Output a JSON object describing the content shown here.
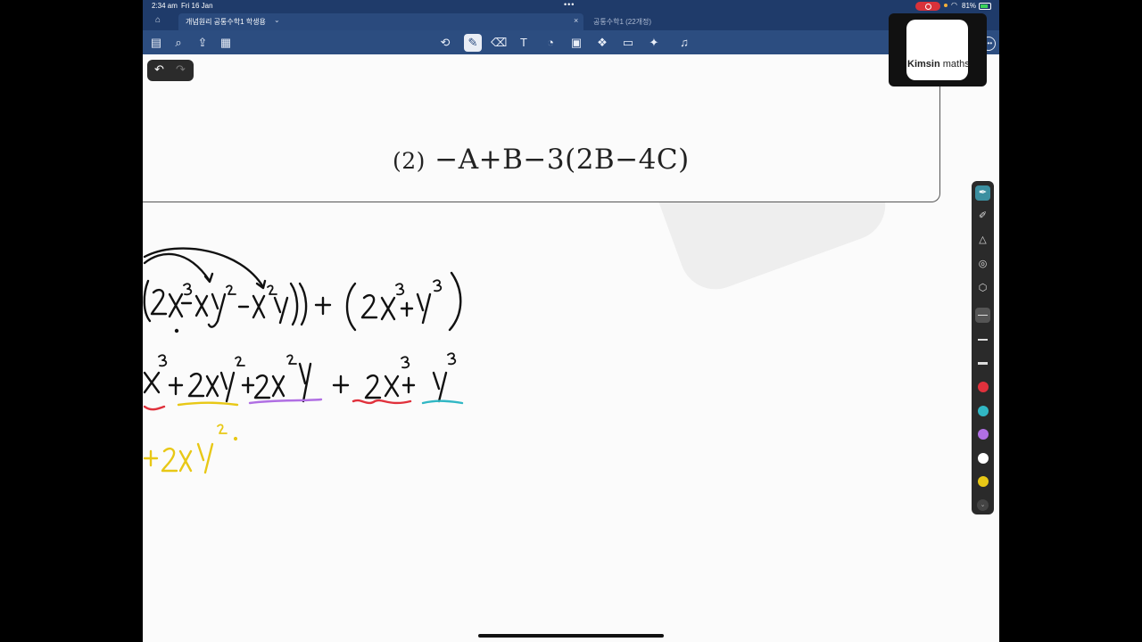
{
  "status": {
    "time": "2:34 am",
    "date": "Fri 16 Jan",
    "battery": "81%"
  },
  "tabs": [
    {
      "label": "개념원리 공통수학1 학생용"
    },
    {
      "label": "공통수학1 (22개정)"
    }
  ],
  "toolbar": {
    "icons": [
      "sidebar-icon",
      "search-icon",
      "share-icon",
      "bookmark-icon",
      "lasso-icon",
      "pen-icon",
      "eraser-icon",
      "text-box-icon",
      "shapes-icon",
      "image-icon",
      "elements-icon",
      "sticky-note-icon",
      "laser-pointer-icon",
      "microphone-icon",
      "more-icon"
    ],
    "selected": "pen-icon"
  },
  "document": {
    "problem_number": "(2)",
    "problem_expr": "−A+B−3(2B−4C)",
    "handwriting": {
      "line1": "(2x³ − xy² − x²y) + (2x³ + y³)",
      "line2": "x³ + 2xy² + 2x²y  +  2x³ + y³",
      "line3": "+ 2xy²"
    }
  },
  "pen_toolbar": {
    "tools": [
      "fountain-pen",
      "highlighter",
      "pencil",
      "shape-tool",
      "eraser"
    ],
    "colors": [
      "#e0313c",
      "#31b7c4",
      "#b06fe3",
      "#ffffff",
      "#e8c816"
    ]
  },
  "overlay": {
    "brand_bold": "Kimsin",
    "brand_rest": " maths"
  }
}
